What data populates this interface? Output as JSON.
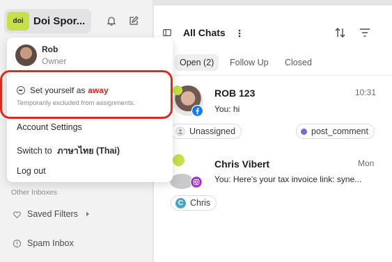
{
  "workspace": {
    "logo_text": "doi",
    "name": "Doi Spor..."
  },
  "user": {
    "name": "Rob",
    "role": "Owner"
  },
  "status_menu": {
    "prefix": "Set yourself as",
    "status_word": "away",
    "description": "Temporarily excluded from assignments."
  },
  "menu": {
    "account_settings": "Account Settings",
    "switch_prefix": "Switch to",
    "switch_language": "ภาษาไทย (Thai)",
    "logout": "Log out"
  },
  "sidebar": {
    "section_label": "Other Inboxes",
    "items": [
      {
        "label": "Saved Filters"
      },
      {
        "label": "Spam Inbox"
      }
    ]
  },
  "main": {
    "title": "All Chats",
    "tabs": [
      {
        "label": "Open (2)"
      },
      {
        "label": "Follow Up"
      },
      {
        "label": "Closed"
      }
    ],
    "conversations": [
      {
        "name": "ROB 123",
        "time": "10:31",
        "message": "You: hi",
        "assignee": "Unassigned",
        "tag": "post_comment"
      },
      {
        "name": "Chris Vibert",
        "time": "Mon",
        "message": "You: Here's your tax invoice link: syne...",
        "assignee_initial": "C",
        "assignee": "Chris"
      }
    ]
  },
  "colors": {
    "accent_red": "#e0281c",
    "brand_green": "#c5e04a",
    "tag_dot": "#6b6fe0",
    "facebook_blue": "#1877f2"
  }
}
